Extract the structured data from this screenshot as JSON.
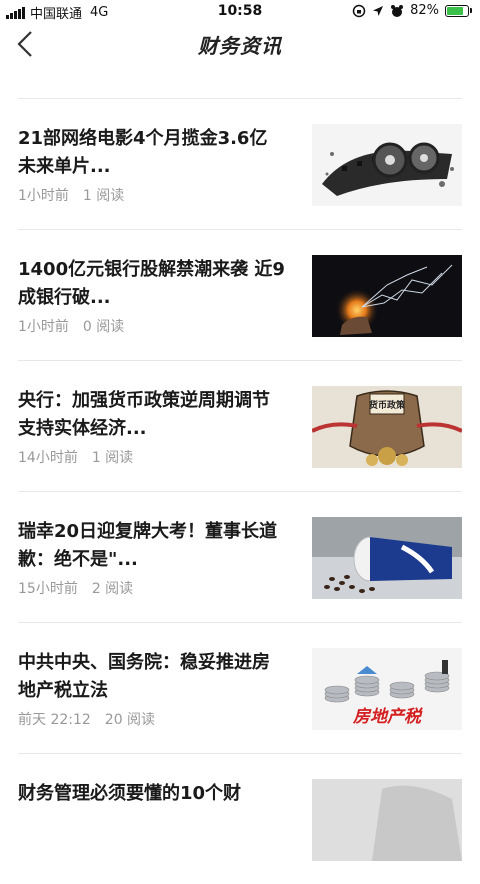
{
  "status_bar": {
    "carrier": "中国联通",
    "network": "4G",
    "time": "10:58",
    "battery": "82%",
    "battery_level": 0.82
  },
  "nav": {
    "title": "财务资讯",
    "back_icon": "chevron-left-icon"
  },
  "articles": [
    {
      "title": "21部网络电影4个月揽金3.6亿 未来单片...",
      "time": "1小时前",
      "reads": "1 阅读",
      "thumb": "film-reel"
    },
    {
      "title": "1400亿元银行股解禁潮来袭 近9成银行破...",
      "time": "1小时前",
      "reads": "0 阅读",
      "thumb": "glowing-chart"
    },
    {
      "title": "央行：加强货币政策逆周期调节 支持实体经济...",
      "time": "14小时前",
      "reads": "1 阅读",
      "thumb": "monetary-policy-cartoon"
    },
    {
      "title": "瑞幸20日迎复牌大考！董事长道歉：绝不是\"...",
      "time": "15小时前",
      "reads": "2 阅读",
      "thumb": "coffee-cup"
    },
    {
      "title": "中共中央、国务院：稳妥推进房地产税立法",
      "time": "前天 22:12",
      "reads": "20 阅读",
      "thumb": "property-tax"
    },
    {
      "title": "财务管理必须要懂的10个财",
      "time": "",
      "reads": "",
      "thumb": "partial"
    }
  ],
  "thumb_labels": {
    "monetary": "货币政策",
    "property_tax": "房地产税"
  },
  "colors": {
    "battery_green": "#3bc14a",
    "meta_gray": "#999999",
    "title_black": "#1a1a1a",
    "property_red": "#d42020"
  }
}
